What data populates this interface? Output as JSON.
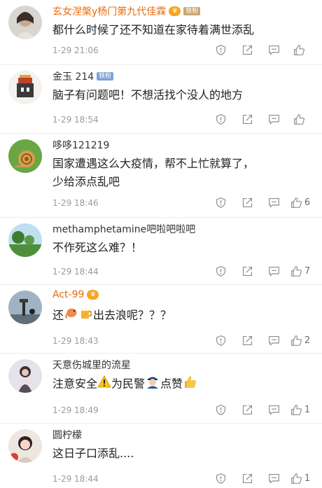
{
  "comments": [
    {
      "name": "玄女涅槃y杨门第九代佳霖",
      "name_color": "orange",
      "badges": [
        "铁粉"
      ],
      "text": "都什么时候了还不知道在家待着满世添乱",
      "time": "1-29 21:06",
      "likes": ""
    },
    {
      "name": "金玉 214",
      "name_color": "gray",
      "badges": [
        "铁粉"
      ],
      "text": "脑子有问题吧！不想活找个没人的地方",
      "time": "1-29 18:54",
      "likes": ""
    },
    {
      "name": "哆哆121219",
      "name_color": "gray",
      "badges": [],
      "text": "国家遭遇这么大疫情，帮不上忙就算了，少给添点乱吧",
      "time": "1-29 18:46",
      "likes": "6"
    },
    {
      "name": "methamphetamine吧啦吧啦吧",
      "name_color": "gray",
      "badges": [],
      "text": "不作死这么难？！",
      "time": "1-29 18:44",
      "likes": "7"
    },
    {
      "name": "Act-99",
      "name_color": "orange",
      "badges": [],
      "text_parts": [
        "还",
        "出去浪呢？？？"
      ],
      "time": "1-29 18:43",
      "likes": "2"
    },
    {
      "name": "天意伤城里的流星",
      "name_color": "gray",
      "badges": [],
      "text_parts": [
        "注意安全",
        "为民警",
        "点赞"
      ],
      "time": "1-29 18:49",
      "likes": "1"
    },
    {
      "name": "圆柠檬",
      "name_color": "gray",
      "badges": [],
      "text": "这日子口添乱....",
      "time": "1-29 18:44",
      "likes": "1"
    }
  ],
  "icons": {
    "report": "report-icon",
    "repost": "repost-icon",
    "reply": "reply-icon",
    "like": "like-icon"
  },
  "colors": {
    "orange_name": "#e86b0c",
    "meta_gray": "#9a9a9a",
    "icon_gray": "#8e8e8e"
  }
}
